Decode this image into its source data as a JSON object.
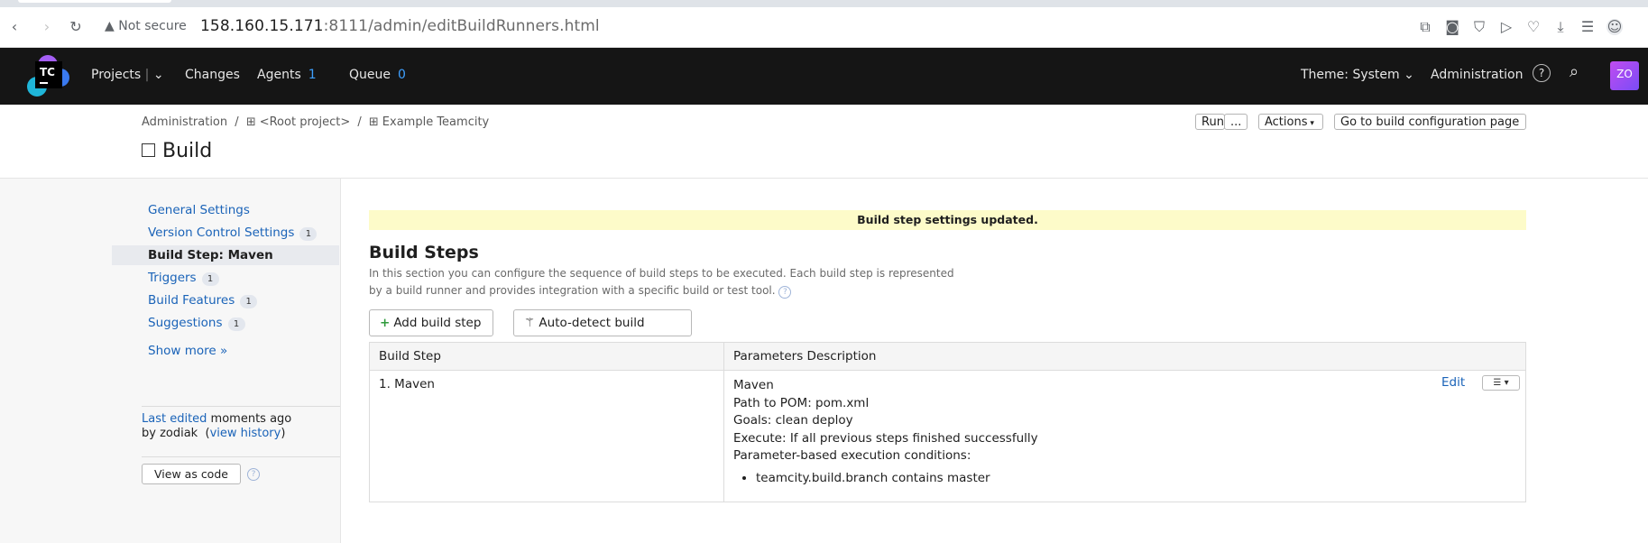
{
  "browser": {
    "security_label": "Not secure",
    "url_host": "158.160.15.171",
    "url_rest": ":8111/admin/editBuildRunners.html"
  },
  "header": {
    "logo_text": "TC",
    "nav": {
      "projects": "Projects",
      "changes": "Changes",
      "agents": "Agents",
      "agents_count": "1",
      "queue": "Queue",
      "queue_count": "0"
    },
    "theme": "Theme: System",
    "administration": "Administration",
    "avatar_initials": "ZO"
  },
  "breadcrumb": {
    "item1": "Administration",
    "sep": "/",
    "item2": "<Root project>",
    "item3": "Example Teamcity"
  },
  "page_title": "Build",
  "top_buttons": {
    "run": "Run",
    "more": "...",
    "actions": "Actions",
    "go_to_config": "Go to build configuration page"
  },
  "sidebar": {
    "items": [
      {
        "label": "General Settings",
        "badge": ""
      },
      {
        "label": "Version Control Settings",
        "badge": "1"
      },
      {
        "label": "Build Step: Maven",
        "badge": ""
      },
      {
        "label": "Triggers",
        "badge": "1"
      },
      {
        "label": "Build Features",
        "badge": "1"
      },
      {
        "label": "Suggestions",
        "badge": "1"
      }
    ],
    "show_more": "Show more »",
    "last_edited_link": "Last edited",
    "last_edited_time": " moments ago",
    "by_user": "by zodiak",
    "view_history": "view history",
    "view_as_code": "View as code"
  },
  "main": {
    "notice": "Build step settings updated.",
    "heading": "Build Steps",
    "description_line1": "In this section you can configure the sequence of build steps to be executed. Each build step is represented",
    "description_line2": "by a build runner and provides integration with a specific build or test tool.",
    "add_step": "Add build step",
    "auto_detect": "Auto-detect build steps",
    "table": {
      "col1": "Build Step",
      "col2": "Parameters Description",
      "rows": [
        {
          "step": "1. Maven",
          "params": [
            "Maven",
            "Path to POM: pom.xml",
            "Goals: clean deploy",
            "Execute: If all previous steps finished successfully",
            "Parameter-based execution conditions:"
          ],
          "conditions": [
            "teamcity.build.branch contains master"
          ],
          "edit": "Edit"
        }
      ]
    }
  },
  "colors": {
    "header_bg": "#151515",
    "link": "#1a63b8",
    "notice_bg": "#fdfbc9",
    "counter": "#3ea0ff"
  }
}
